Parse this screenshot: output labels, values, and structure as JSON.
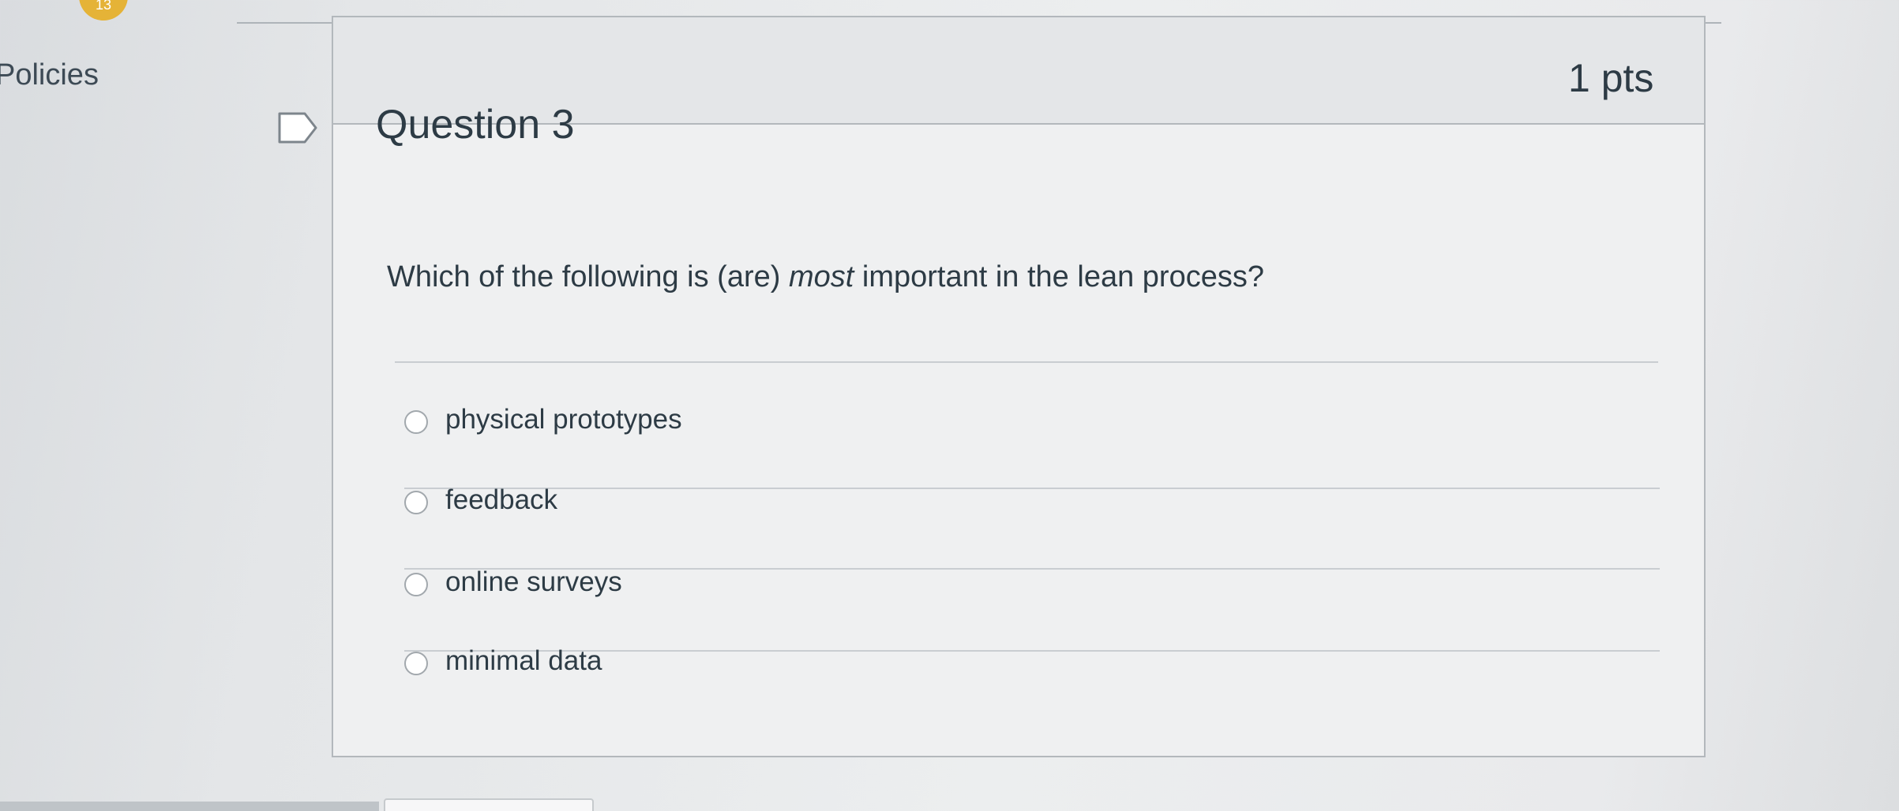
{
  "sidebar": {
    "policies_label": "Policies",
    "badge_count": "13"
  },
  "question": {
    "title": "Question 3",
    "points": "1 pts",
    "text_before": "Which of the following is (are) ",
    "text_emphasis": "most",
    "text_after": " important in the lean process?",
    "answers": [
      {
        "label": "physical prototypes",
        "selected": false
      },
      {
        "label": "feedback",
        "selected": false
      },
      {
        "label": "online surveys",
        "selected": false
      },
      {
        "label": "minimal data",
        "selected": false
      }
    ]
  },
  "icons": {
    "flag": "flag-outline-icon"
  },
  "colors": {
    "text": "#2d3b45",
    "badge": "#e5b337",
    "header_bg": "#e4e6e8",
    "border": "#b3b8bc"
  }
}
